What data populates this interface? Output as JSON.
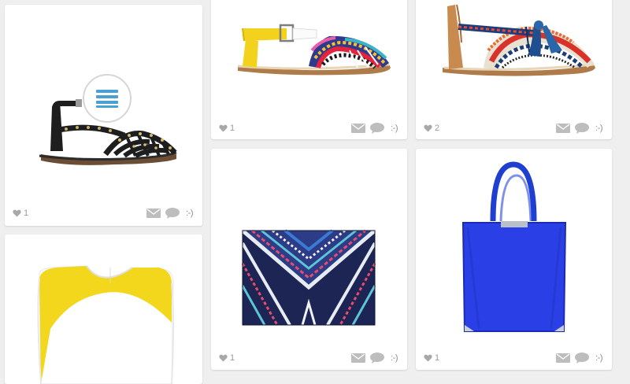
{
  "cards": [
    {
      "id": "black-studded-sandal",
      "likes": "1",
      "menu_icon": "hamburger-menu-icon"
    },
    {
      "id": "yellow-ethnic-sandal",
      "likes": "1"
    },
    {
      "id": "tassel-ethnic-sandal",
      "likes": "2"
    },
    {
      "id": "yellow-white-top"
    },
    {
      "id": "geometric-clutch",
      "likes": "1"
    },
    {
      "id": "blue-tote",
      "likes": "1"
    }
  ],
  "action_icons": [
    "heart-icon",
    "mail-icon",
    "comment-icon",
    "emoticon-icon"
  ],
  "emoticon_text": ":-)",
  "colors": {
    "accent_menu": "#4a9fd5",
    "icon_gray": "#a8a8a8",
    "background": "#efefef"
  }
}
